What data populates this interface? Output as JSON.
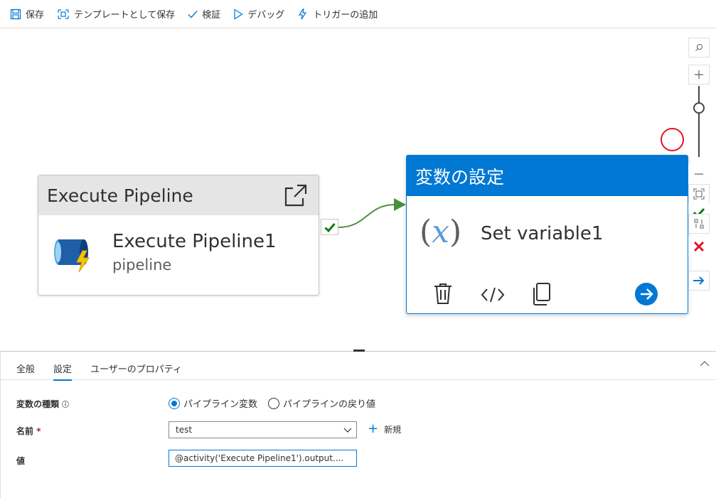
{
  "toolbar": {
    "save": "保存",
    "save_template": "テンプレートとして保存",
    "validate": "検証",
    "debug": "デバッグ",
    "add_trigger": "トリガーの追加"
  },
  "canvas": {
    "execute_node": {
      "header": "Execute Pipeline",
      "name": "Execute Pipeline1",
      "type": "pipeline"
    },
    "set_variable_node": {
      "header": "変数の設定",
      "name": "Set variable1"
    }
  },
  "panel": {
    "tabs": [
      "全般",
      "設定",
      "ユーザーのプロパティ"
    ],
    "active_tab": "設定",
    "fields": {
      "variable_type_label": "変数の種類",
      "variable_type_info": "ⓘ",
      "radio_pipeline_variable": "パイプライン変数",
      "radio_pipeline_return": "パイプラインの戻り値",
      "name_label": "名前",
      "required_mark": "*",
      "name_value": "test",
      "new_label": "新規",
      "value_label": "値",
      "value_text": "@activity('Execute Pipeline1').output...."
    }
  },
  "colors": {
    "accent": "#0078d4",
    "success": "#107c10",
    "error": "#e81123"
  }
}
